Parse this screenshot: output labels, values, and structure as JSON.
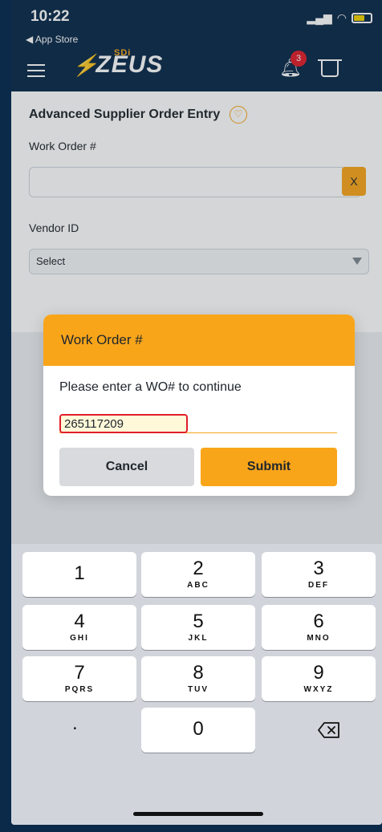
{
  "status_bar": {
    "time": "10:22",
    "back_label": "◀ App Store"
  },
  "header": {
    "logo_text": "ZEUS",
    "logo_badge": "SDi",
    "notification_count": "3"
  },
  "page": {
    "title": "Advanced Supplier Order Entry",
    "work_order_label": "Work Order #",
    "clear_label": "X",
    "vendor_label": "Vendor ID",
    "vendor_select_value": "Select"
  },
  "modal": {
    "title": "Work Order #",
    "prompt": "Please enter a WO# to continue",
    "input_value": "265117209",
    "cancel_label": "Cancel",
    "submit_label": "Submit"
  },
  "keyboard": {
    "keys": [
      {
        "num": "1",
        "letters": ""
      },
      {
        "num": "2",
        "letters": "ABC"
      },
      {
        "num": "3",
        "letters": "DEF"
      },
      {
        "num": "4",
        "letters": "GHI"
      },
      {
        "num": "5",
        "letters": "JKL"
      },
      {
        "num": "6",
        "letters": "MNO"
      },
      {
        "num": "7",
        "letters": "PQRS"
      },
      {
        "num": "8",
        "letters": "TUV"
      },
      {
        "num": "9",
        "letters": "WXYZ"
      },
      {
        "num": "0",
        "letters": ""
      }
    ],
    "dot_label": "."
  },
  "colors": {
    "brand_orange": "#f9a51a",
    "navy": "#0b2a4a",
    "alert_red": "#e11d2a"
  }
}
